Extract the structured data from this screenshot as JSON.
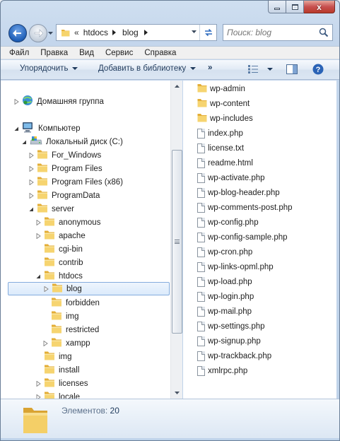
{
  "window": {
    "caption": {
      "close_symbol": "x"
    }
  },
  "nav": {
    "back_icon": "arrow-left-icon",
    "forward_icon": "arrow-right-icon",
    "address": {
      "overflow": "«",
      "crumbs": [
        "htdocs",
        "blog"
      ]
    },
    "refresh_icon": "refresh-icon",
    "search": {
      "placeholder": "Поиск: blog"
    }
  },
  "menu": [
    "Файл",
    "Правка",
    "Вид",
    "Сервис",
    "Справка"
  ],
  "commandbar": {
    "organize": "Упорядочить",
    "add_to_library": "Добавить в библиотеку",
    "more": "»",
    "view_icon": "view-options-icon",
    "preview_icon": "preview-pane-icon",
    "help_icon": "help-icon",
    "help_symbol": "?"
  },
  "tree": {
    "homegroup": "Домашняя группа",
    "computer": "Компьютер",
    "drive": "Локальный диск (C:)",
    "items": [
      "For_Windows",
      "Program Files",
      "Program Files (x86)",
      "ProgramData",
      "server",
      "anonymous",
      "apache",
      "cgi-bin",
      "contrib",
      "htdocs",
      "blog",
      "forbidden",
      "img",
      "restricted",
      "xampp",
      "img",
      "install",
      "licenses",
      "locale"
    ]
  },
  "files": [
    {
      "name": "wp-admin",
      "type": "folder"
    },
    {
      "name": "wp-content",
      "type": "folder"
    },
    {
      "name": "wp-includes",
      "type": "folder"
    },
    {
      "name": "index.php",
      "type": "php"
    },
    {
      "name": "license.txt",
      "type": "txt"
    },
    {
      "name": "readme.html",
      "type": "html"
    },
    {
      "name": "wp-activate.php",
      "type": "php"
    },
    {
      "name": "wp-blog-header.php",
      "type": "php"
    },
    {
      "name": "wp-comments-post.php",
      "type": "php"
    },
    {
      "name": "wp-config.php",
      "type": "php"
    },
    {
      "name": "wp-config-sample.php",
      "type": "php"
    },
    {
      "name": "wp-cron.php",
      "type": "php"
    },
    {
      "name": "wp-links-opml.php",
      "type": "php"
    },
    {
      "name": "wp-load.php",
      "type": "php"
    },
    {
      "name": "wp-login.php",
      "type": "php"
    },
    {
      "name": "wp-mail.php",
      "type": "php"
    },
    {
      "name": "wp-settings.php",
      "type": "php"
    },
    {
      "name": "wp-signup.php",
      "type": "php"
    },
    {
      "name": "wp-trackback.php",
      "type": "php"
    },
    {
      "name": "xmlrpc.php",
      "type": "php"
    }
  ],
  "details": {
    "label": "Элементов:",
    "count": "20"
  },
  "colors": {
    "folder": "#f2c94c",
    "selection_border": "#84acdd",
    "frame": "#bfd3ea"
  }
}
